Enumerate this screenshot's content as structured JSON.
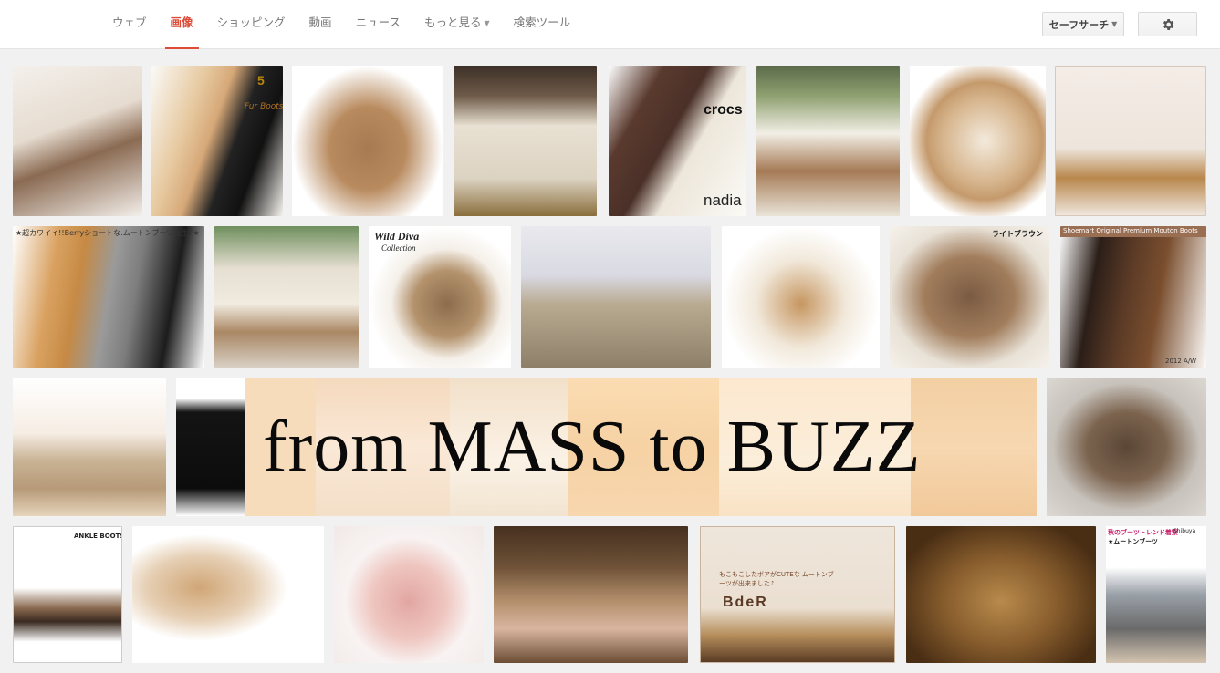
{
  "nav": {
    "tabs": [
      {
        "label": "ウェブ"
      },
      {
        "label": "画像"
      },
      {
        "label": "ショッピング"
      },
      {
        "label": "動画"
      },
      {
        "label": "ニュース"
      },
      {
        "label": "もっと見る"
      },
      {
        "label": "検索ツール"
      }
    ],
    "active_tab": "画像",
    "safe_search_label": "セーフサーチ",
    "settings_icon": "gear-icon"
  },
  "banner": {
    "title": "from MASS to BUZZ"
  },
  "image_text": {
    "boots5_label": "5",
    "boots5_sub": "Fur Boots",
    "crocs_logo": "crocs",
    "nadia_logo": "nadia",
    "berry_caption": "★超カワイイ!!Berryショートな.ムートンブーツ誕生♪★",
    "wild_diva_logo": "Wild Diva",
    "wild_diva_sub": "Collection",
    "light_brown_label": "ライトブラウン",
    "shoemart_caption": "Shoemart Original Premium Mouton Boots",
    "shoemart_year": "2012 A/W",
    "ankle_boots_label": "ANKLE BOOTS",
    "bder_caption": "もこもこしたボアがCUTEな ムートンブーツが出来ました♪",
    "bder_logo": "BdeR",
    "autumn_label": "秋のブーツトレンド着察",
    "autumn_sub": "★ムートンブーツ",
    "autumn_brand": "Shibuya"
  },
  "colors": {
    "accent": "#dd4b39",
    "tab_text": "#777777",
    "page_bg": "#f1f1f1"
  }
}
